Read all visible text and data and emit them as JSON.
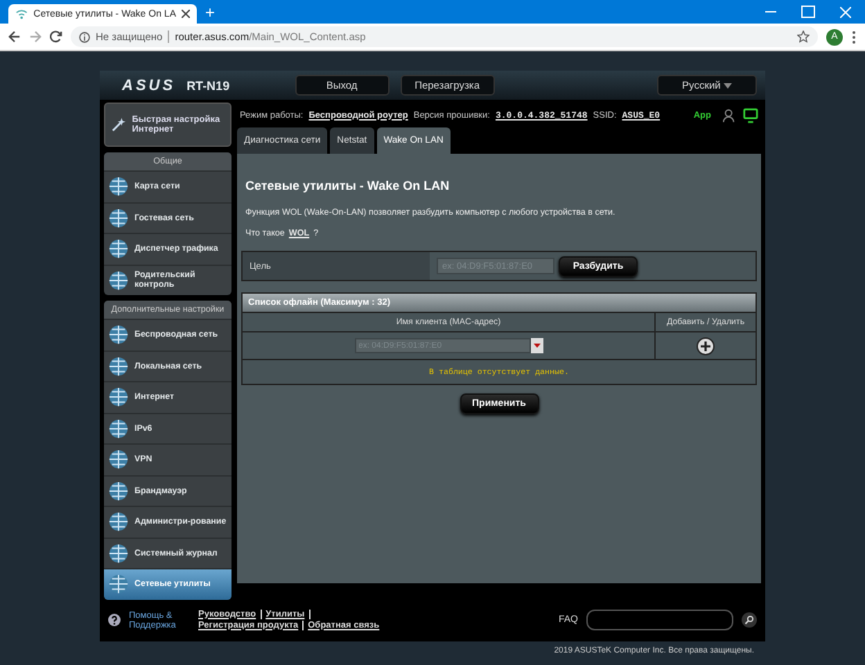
{
  "browser": {
    "tab_title": "Сетевые утилиты - Wake On LA",
    "new_tab": "+",
    "security": "Не защищено",
    "url_host": "router.asus.com",
    "url_path": "/Main_WOL_Content.asp",
    "avatar": "A"
  },
  "header": {
    "logo": "ASUS",
    "model": "RT-N19",
    "buttons": [
      "Выход",
      "Перезагрузка"
    ],
    "language": "Русский"
  },
  "status": {
    "mode_label": "Режим работы:",
    "mode": "Беспроводной роутер",
    "fw_label": "Версия прошивки:",
    "fw": "3.0.0.4.382_51748",
    "ssid_label": "SSID:",
    "ssid": "ASUS_E0",
    "app": "App"
  },
  "sidebar": {
    "quick": "Быстрая настройка Интернет",
    "groups": [
      {
        "title": "Общие",
        "items": [
          {
            "label": "Карта сети",
            "selected": false
          },
          {
            "label": "Гостевая сеть",
            "selected": false
          },
          {
            "label": "Диспетчер трафика",
            "selected": false
          },
          {
            "label": "Родительский контроль",
            "selected": false
          }
        ]
      },
      {
        "title": "Дополнительные настройки",
        "items": [
          {
            "label": "Беспроводная сеть",
            "selected": false
          },
          {
            "label": "Локальная сеть",
            "selected": false
          },
          {
            "label": "Интернет",
            "selected": false
          },
          {
            "label": "IPv6",
            "selected": false
          },
          {
            "label": "VPN",
            "selected": false
          },
          {
            "label": "Брандмауэр",
            "selected": false
          },
          {
            "label": "Администри-рование",
            "selected": false
          },
          {
            "label": "Системный журнал",
            "selected": false
          },
          {
            "label": "Сетевые утилиты",
            "selected": true
          }
        ]
      }
    ]
  },
  "tabs": [
    {
      "label": "Диагностика сети",
      "selected": false
    },
    {
      "label": "Netstat",
      "selected": false
    },
    {
      "label": "Wake On LAN",
      "selected": true
    }
  ],
  "content": {
    "title": "Сетевые утилиты - Wake On LAN",
    "description": "Функция WOL (Wake-On-LAN) позволяет разбудить компьютер с любого устройства в сети.",
    "what_is": "Что такое",
    "what_is_link": "WOL",
    "what_is_end": "?",
    "target_label": "Цель",
    "target_placeholder": "ex: 04:D9:F5:01:87:E0",
    "wake_button": "Разбудить",
    "list": {
      "title": "Список офлайн (Максимум : 32)",
      "columns": [
        "Имя клиента (MAC-адрес)",
        "Добавить / Удалить"
      ],
      "select_placeholder": "ex: 04:D9:F5:01:87:E0",
      "empty": "В таблице отсутствует данные."
    },
    "apply_button": "Применить"
  },
  "footer": {
    "help": "Помощь & Поддержка",
    "links": [
      "Руководство",
      "Утилиты",
      "Регистрация продукта",
      "Обратная связь"
    ],
    "faq": "FAQ",
    "copyright": "2019 ASUSTeK Computer Inc. Все права защищены."
  }
}
